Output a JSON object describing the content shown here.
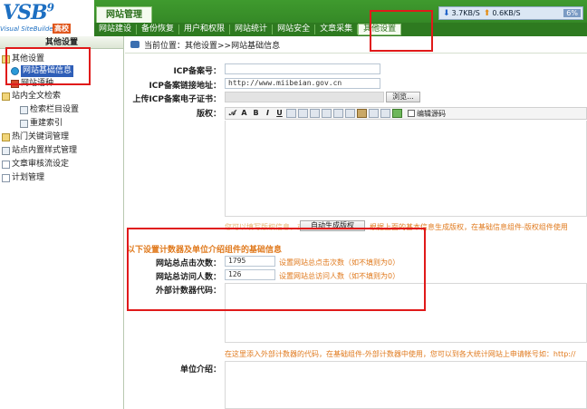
{
  "header": {
    "logo_text": "VSB",
    "logo_version": "9",
    "logo_subtitle": "Visual SiteBuilder",
    "edition": "高校",
    "main_tab": "网站管理",
    "nav_items": [
      "网站建设",
      "备份恢复",
      "用户和权限",
      "网站统计",
      "网站安全",
      "文章采集",
      "其他设置"
    ],
    "active_nav": "其他设置",
    "download_speed": "3.7KB/S",
    "upload_speed": "0.6KB/S",
    "cpu_percent": "6%"
  },
  "sidebar": {
    "title": "其他设置",
    "items": [
      {
        "label": "其他设置",
        "icon": "folder-icon"
      },
      {
        "label": "网站基础信息",
        "icon": "globe-icon",
        "selected": true
      },
      {
        "label": "网站语种",
        "icon": "flag-icon"
      },
      {
        "label": "站内全文检索",
        "icon": "folder-icon"
      },
      {
        "label": "检索栏目设置",
        "icon": "grid-icon"
      },
      {
        "label": "重建索引",
        "icon": "grid-icon"
      },
      {
        "label": "热门关键词管理",
        "icon": "folder-icon"
      },
      {
        "label": "站点内置样式管理",
        "icon": "stack-icon"
      },
      {
        "label": "文章审核流设定",
        "icon": "page-icon"
      },
      {
        "label": "计划管理",
        "icon": "page-icon"
      }
    ]
  },
  "content": {
    "breadcrumb": "当前位置：其他设置>>网站基础信息",
    "icp_label": "ICP备案号：",
    "icp_value": "",
    "icp_link_label": "ICP备案链接地址：",
    "icp_link_value": "http://www.miibeian.gov.cn",
    "icp_cert_label": "上传ICP备案电子证书：",
    "browse_button": "浏览...",
    "copyright_label": "版权：",
    "edit_source_label": "编辑源码",
    "copyright_hint_pre": "您可以填写版权信息，或者点击",
    "auto_copyright_button": "自动生成版权",
    "copyright_hint_post": "根据上面的基本信息生成版权，在基础信息组件-版权组件使用",
    "counter_section_title": "以下设置计数器及单位介绍组件的基础信息",
    "total_clicks_label": "网站总点击次数：",
    "total_clicks_value": "1795",
    "total_clicks_hint": "设置网站总点击次数（如不填则为0）",
    "total_visitors_label": "网站总访问人数：",
    "total_visitors_value": "126",
    "total_visitors_hint": "设置网站总访问人数（如不填则为0）",
    "external_counter_label": "外部计数器代码：",
    "external_counter_hint": "在这里添入外部计数器的代码，在基础组件-外部计数器中使用，您可以到各大统计网站上申请帐号如：http://",
    "unit_intro_label": "单位介绍："
  }
}
